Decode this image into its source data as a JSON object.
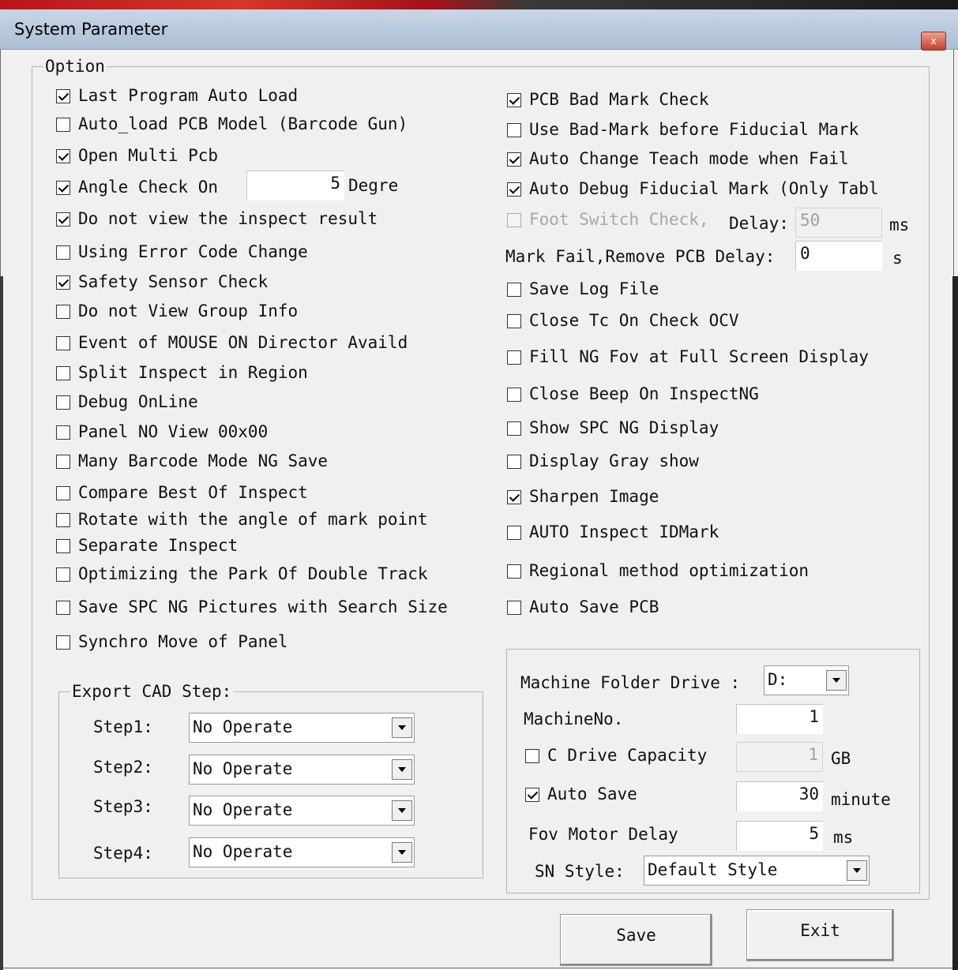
{
  "window": {
    "title": "System Parameter",
    "close_glyph": "x"
  },
  "option_group": {
    "legend": "Option"
  },
  "left_options": [
    {
      "label": "Last Program Auto Load",
      "checked": true
    },
    {
      "label": "Auto_load PCB Model (Barcode Gun)",
      "checked": false
    },
    {
      "label": "Open Multi Pcb",
      "checked": true
    },
    {
      "label": "Angle Check On",
      "checked": true
    },
    {
      "label": "Do not view the inspect result",
      "checked": true
    },
    {
      "label": "Using Error Code Change",
      "checked": false
    },
    {
      "label": "Safety Sensor Check",
      "checked": true
    },
    {
      "label": "Do not View Group Info",
      "checked": false
    },
    {
      "label": "Event of MOUSE ON Director Availd",
      "checked": false
    },
    {
      "label": "Split Inspect in Region",
      "checked": false
    },
    {
      "label": "Debug OnLine",
      "checked": false
    },
    {
      "label": "Panel NO View 00x00",
      "checked": false
    },
    {
      "label": "Many Barcode Mode NG Save",
      "checked": false
    },
    {
      "label": "Compare Best Of Inspect",
      "checked": false
    },
    {
      "label": "Rotate with the angle of mark point",
      "checked": false
    },
    {
      "label": "Separate Inspect",
      "checked": false
    },
    {
      "label": "Optimizing the Park Of Double Track",
      "checked": false
    },
    {
      "label": "Save SPC NG Pictures with Search Size",
      "checked": false
    },
    {
      "label": "Synchro Move of Panel",
      "checked": false
    }
  ],
  "angle_check": {
    "value": "5",
    "unit": "Degre"
  },
  "right_options": [
    {
      "label": "PCB Bad Mark Check",
      "checked": true
    },
    {
      "label": "Use Bad-Mark before Fiducial Mark",
      "checked": false
    },
    {
      "label": "Auto Change Teach mode when Fail",
      "checked": true
    },
    {
      "label": "Auto Debug Fiducial Mark (Only Tabl",
      "checked": true
    },
    {
      "label": "Foot Switch Check,",
      "checked": false,
      "disabled": true
    },
    {
      "label": "Save Log File",
      "checked": false
    },
    {
      "label": "Close Tc On Check OCV",
      "checked": false
    },
    {
      "label": "Fill NG Fov at Full Screen Display",
      "checked": false
    },
    {
      "label": "Close Beep On InspectNG",
      "checked": false
    },
    {
      "label": "Show SPC NG Display",
      "checked": false
    },
    {
      "label": "Display Gray show",
      "checked": false
    },
    {
      "label": "Sharpen Image",
      "checked": true
    },
    {
      "label": "AUTO Inspect IDMark",
      "checked": false
    },
    {
      "label": "Regional method optimization",
      "checked": false
    },
    {
      "label": "Auto Save PCB",
      "checked": false
    }
  ],
  "foot_switch": {
    "delay_label": "Delay:",
    "delay_value": "50",
    "unit": "ms"
  },
  "mark_fail": {
    "label": "Mark Fail,Remove PCB Delay:",
    "value": "0",
    "unit": "s"
  },
  "export_cad": {
    "legend": "Export CAD Step:",
    "steps": [
      {
        "label": "Step1:",
        "value": "No Operate"
      },
      {
        "label": "Step2:",
        "value": "No Operate"
      },
      {
        "label": "Step3:",
        "value": "No Operate"
      },
      {
        "label": "Step4:",
        "value": "No Operate"
      }
    ]
  },
  "machine": {
    "folder_drive_label": "Machine Folder Drive :",
    "folder_drive_value": "D:",
    "machine_no_label": "MachineNo.",
    "machine_no_value": "1",
    "c_drive_label": "C Drive Capacity",
    "c_drive_checked": false,
    "c_drive_value": "1",
    "c_drive_unit": "GB",
    "auto_save_label": "Auto Save",
    "auto_save_checked": true,
    "auto_save_value": "30",
    "auto_save_unit": "minute",
    "fov_label": "Fov Motor Delay",
    "fov_value": "5",
    "fov_unit": "ms",
    "sn_label": "SN Style:",
    "sn_value": "Default Style"
  },
  "buttons": {
    "save": "Save",
    "exit": "Exit"
  }
}
